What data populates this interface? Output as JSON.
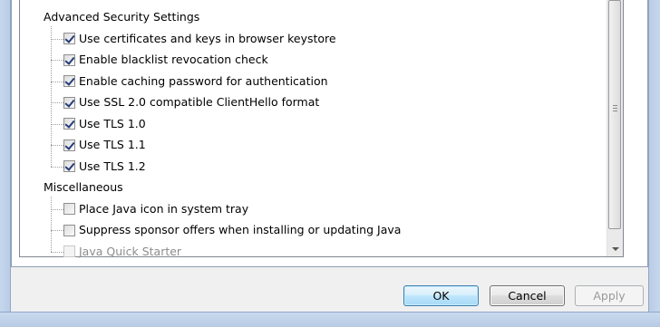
{
  "settings_tree": {
    "sections": [
      {
        "heading": "Advanced Security Settings",
        "items": [
          {
            "label": "Use certificates and keys in browser keystore",
            "checked": true,
            "enabled": true
          },
          {
            "label": "Enable blacklist revocation check",
            "checked": true,
            "enabled": true
          },
          {
            "label": "Enable caching password for authentication",
            "checked": true,
            "enabled": true
          },
          {
            "label": "Use SSL 2.0 compatible ClientHello format",
            "checked": true,
            "enabled": true
          },
          {
            "label": "Use TLS 1.0",
            "checked": true,
            "enabled": true
          },
          {
            "label": "Use TLS 1.1",
            "checked": true,
            "enabled": true
          },
          {
            "label": "Use TLS 1.2",
            "checked": true,
            "enabled": true
          }
        ]
      },
      {
        "heading": "Miscellaneous",
        "items": [
          {
            "label": "Place Java icon in system tray",
            "checked": false,
            "enabled": true
          },
          {
            "label": "Suppress sponsor offers when installing or updating Java",
            "checked": false,
            "enabled": true
          },
          {
            "label": "Java Quick Starter",
            "checked": false,
            "enabled": false
          }
        ]
      }
    ]
  },
  "buttons": {
    "ok_label": "OK",
    "cancel_label": "Cancel",
    "apply_label": "Apply",
    "apply_enabled": false
  }
}
